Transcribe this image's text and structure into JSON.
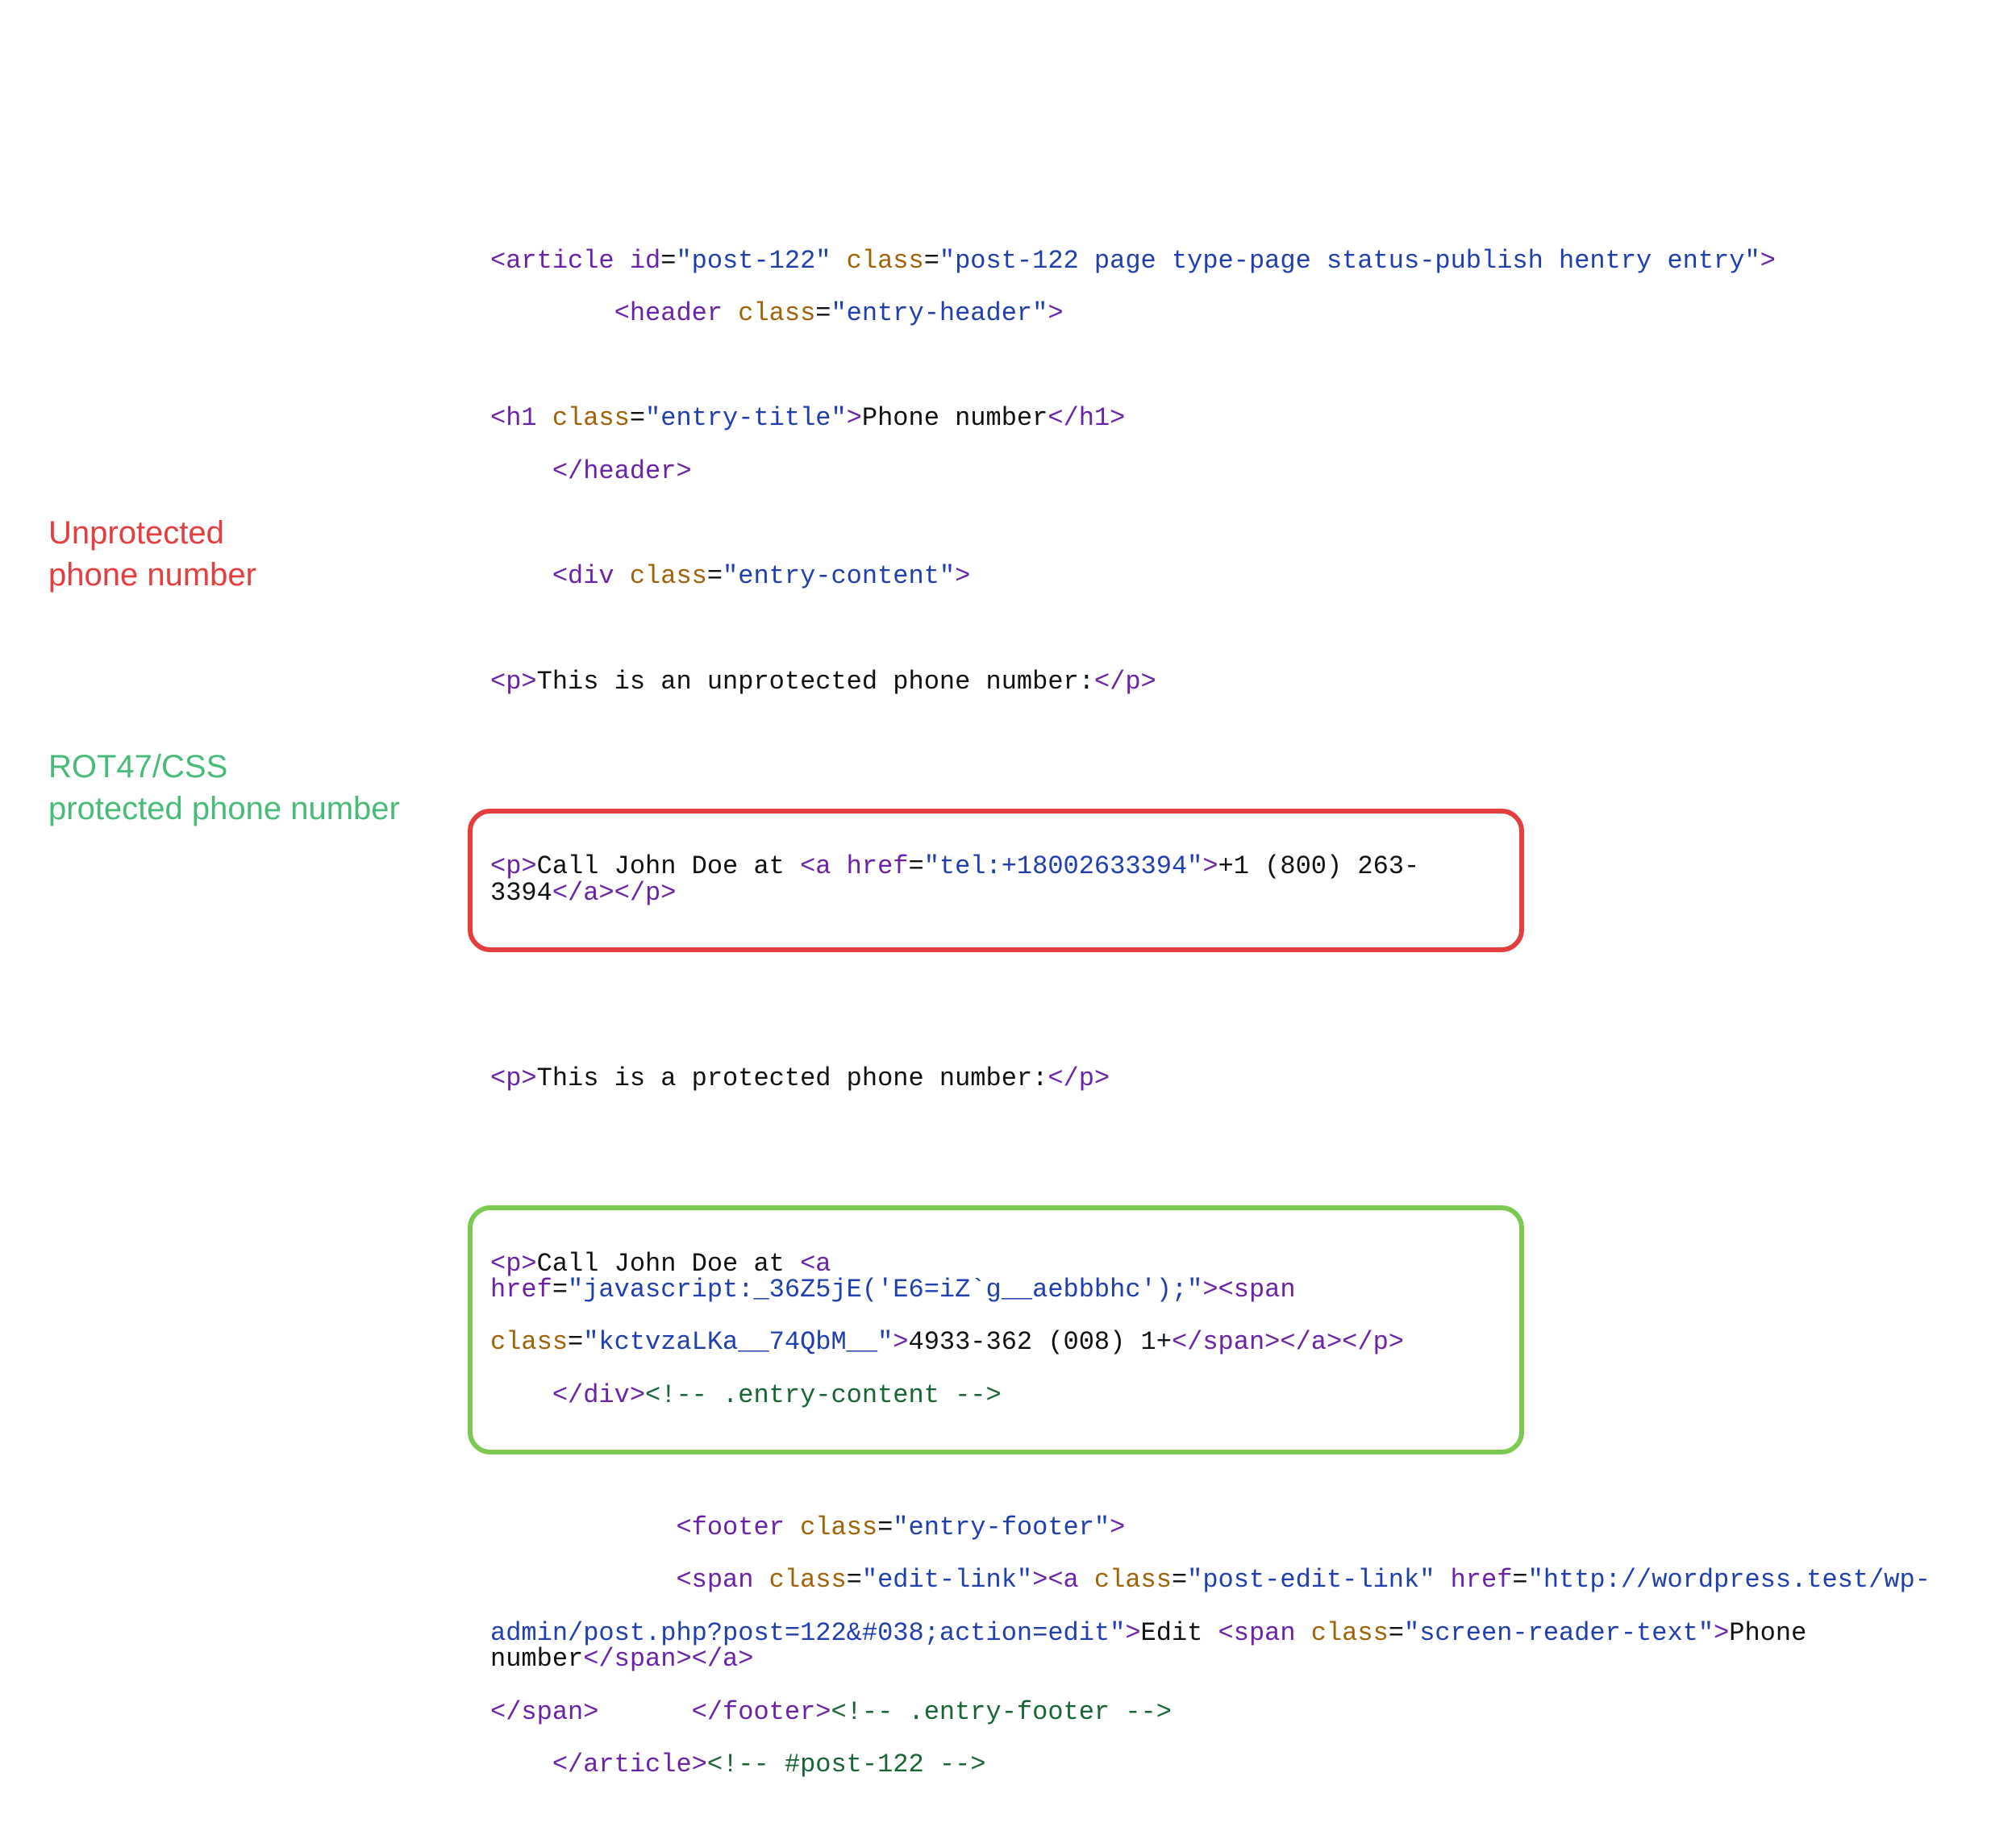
{
  "labels": {
    "unprotected_line1": "Unprotected",
    "unprotected_line2": "phone number",
    "protected_line1": "ROT47/CSS",
    "protected_line2": "protected phone number"
  },
  "code": {
    "l1": {
      "t1": "<article",
      "a1": " id",
      "e1": "=",
      "v1": "\"post-122\"",
      "a2": " class",
      "e2": "=",
      "v2": "\"post-122 page type-page status-publish hentry entry\"",
      "t2": ">"
    },
    "l2": {
      "indent": "        ",
      "t1": "<header",
      "a1": " class",
      "e1": "=",
      "v1": "\"entry-header\"",
      "t2": ">"
    },
    "l3": {
      "t1": "<h1",
      "a1": " class",
      "e1": "=",
      "v1": "\"entry-title\"",
      "t2": ">",
      "txt": "Phone number",
      "t3": "</h1>"
    },
    "l4": {
      "indent": "    ",
      "t1": "</header>"
    },
    "l5": {
      "indent": "    ",
      "t1": "<div",
      "a1": " class",
      "e1": "=",
      "v1": "\"entry-content\"",
      "t2": ">"
    },
    "l6": {
      "t1": "<p>",
      "txt": "This is an unprotected phone number:",
      "t2": "</p>"
    },
    "box1": {
      "t1": "<p>",
      "txt1": "Call John Doe at ",
      "t2": "<a",
      "a1": " href",
      "e1": "=",
      "v1": "\"tel:+18002633394\"",
      "t3": ">",
      "txt2": "+1 (800) 263-3394",
      "t4": "</a></p>"
    },
    "l7": {
      "t1": "<p>",
      "txt": "This is a protected phone number:",
      "t2": "</p>"
    },
    "box2": {
      "r1": {
        "t1": "<p>",
        "txt1": "Call John Doe at ",
        "t2": "<a",
        "a1": " href",
        "e1": "=",
        "v1": "\"javascript:_36Z5jE('E6=iZ`g__aebbbhc');\"",
        "t3": "><span"
      },
      "r2": {
        "a1": "class",
        "e1": "=",
        "v1": "\"kctvzaLKa__74QbM__\"",
        "t1": ">",
        "txt": "4933-362 (008) 1+",
        "t2": "</span></a></p>"
      },
      "r3": {
        "indent": "    ",
        "t1": "</div>",
        "c1": "<!-- .entry-content -->"
      }
    },
    "l8": {
      "indent": "            ",
      "t1": "<footer",
      "a1": " class",
      "e1": "=",
      "v1": "\"entry-footer\"",
      "t2": ">"
    },
    "l9a": {
      "indent": "            ",
      "t1": "<span",
      "a1": " class",
      "e1": "=",
      "v1": "\"edit-link\"",
      "t2": "><a",
      "a2": " class",
      "e2": "=",
      "v2": "\"post-edit-link\"",
      "a3": " href",
      "e3": "=",
      "v3": "\"http://wordpress.test/wp-"
    },
    "l9b": {
      "v1": "admin/post.php?post=122&#038;action=edit\"",
      "t1": ">",
      "txt1": "Edit ",
      "t2": "<span",
      "a1": " class",
      "e1": "=",
      "v2": "\"screen-reader-text\"",
      "t3": ">",
      "txt2": "Phone number",
      "t4": "</span></a>"
    },
    "l10": {
      "t1": "</span>",
      "sp": "      ",
      "t2": "</footer>",
      "c1": "<!-- .entry-footer -->"
    },
    "l11": {
      "indent": "    ",
      "t1": "</article>",
      "c1": "<!-- #post-122 -->"
    }
  }
}
